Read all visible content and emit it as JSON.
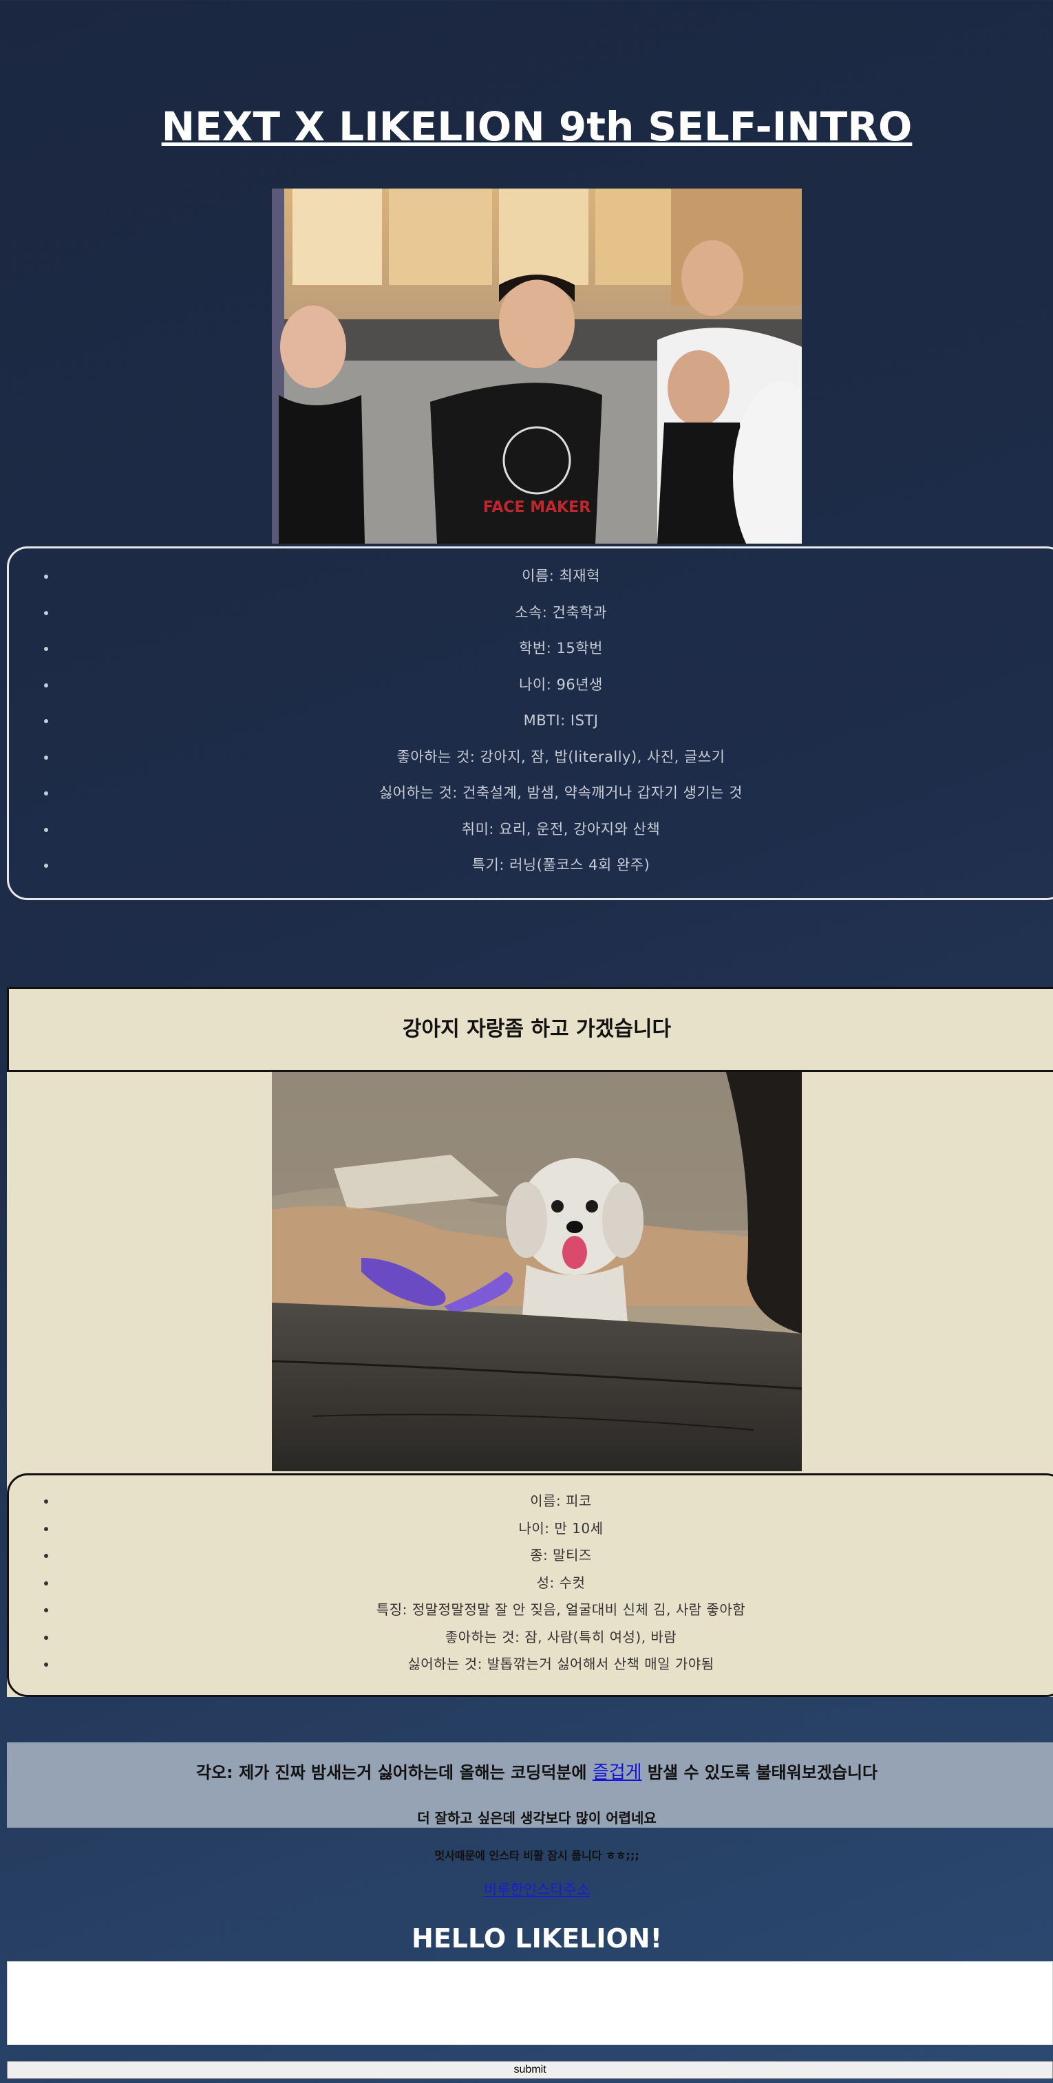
{
  "page_title": "NEXT X LIKELION 9th SELF-INTRO",
  "profile": {
    "items": [
      "이름: 최재혁",
      "소속: 건축학과",
      "학번: 15학번",
      "나이: 96년생",
      "MBTI: ISTJ",
      "좋아하는 것: 강아지, 잠, 밥(literally), 사진, 글쓰기",
      "싫어하는 것: 건축설계, 밤샘, 약속깨거나 갑자기 생기는 것",
      "취미: 요리, 운전, 강아지와 산책",
      "특기: 러닝(풀코스 4회 완주)"
    ]
  },
  "dog_section": {
    "header": "강아지 자랑좀 하고 가겠습니다",
    "items": [
      "이름: 피코",
      "나이: 만 10세",
      "종: 말티즈",
      "성: 수컷",
      "특징: 정말정말정말 잘 안 짖음, 얼굴대비 신체 김, 사람 좋아함",
      "좋아하는 것: 잠, 사람(특히 여성), 바람",
      "싫어하는 것: 발톱깎는거 싫어해서 산책 매일 가야됨"
    ]
  },
  "resolution": {
    "prefix": "각오: 제가 진짜 밤새는거 싫어하는데 올해는 코딩덕분에 ",
    "link": "즐겁게",
    "suffix": " 밤샐 수 있도록 불태워보겠습니다",
    "sub": "더 잘하고 싶은데 생각보다 많이 어렵네요"
  },
  "insta": {
    "note": "멋사때문에 인스타 비활 잠시 풉니다 ㅎㅎ;;;",
    "link": "비루한인스타주소"
  },
  "hello": "HELLO LIKELION!",
  "form": {
    "submit_label": "submit"
  },
  "colors": {
    "background_top": "#1b2740",
    "background_bottom": "#2c4a72",
    "beige": "#e8e1c9",
    "resolution_bg": "#95a3b4",
    "link": "#1414d8"
  }
}
